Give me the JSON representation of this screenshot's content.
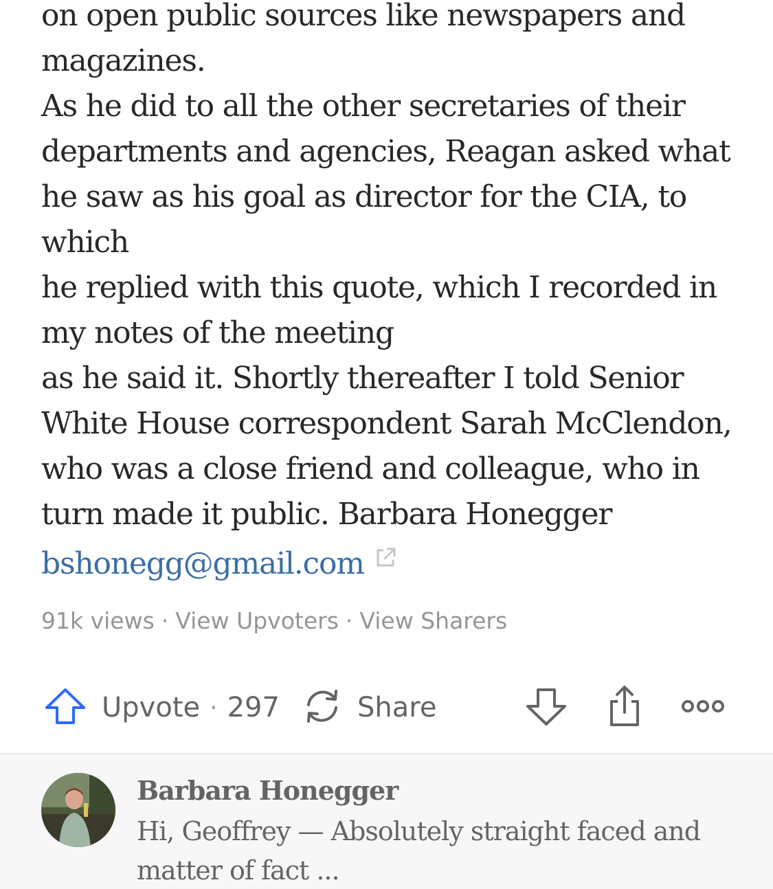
{
  "answer": {
    "lines": [
      "on open public sources like newspapers and",
      "magazines.",
      "As he did to all the other secretaries of their",
      "departments and agencies, Reagan asked what",
      "he saw as his goal as director for the CIA, to",
      "which",
      "he replied with this quote, which I recorded in",
      "my notes of the meeting",
      "as he said it.  Shortly thereafter I told Senior",
      "White House correspondent Sarah McClendon,",
      "who was a close friend and colleague, who in",
      "turn made it public.  Barbara Honegger"
    ],
    "email": "bshonegg@gmail.com"
  },
  "meta": {
    "views": "91k views",
    "separator": "·",
    "upvoters": "View Upvoters",
    "sharers": "View Sharers"
  },
  "actions": {
    "upvote_label": "Upvote",
    "separator": "·",
    "upvote_count": "297",
    "share_label": "Share",
    "accent_color": "#2e69ff",
    "icon_color": "#636466"
  },
  "comment": {
    "author": "Barbara Honegger",
    "text_lines": [
      "Hi, Geoffrey — Absolutely straight faced and",
      "matter of fact ..."
    ]
  }
}
